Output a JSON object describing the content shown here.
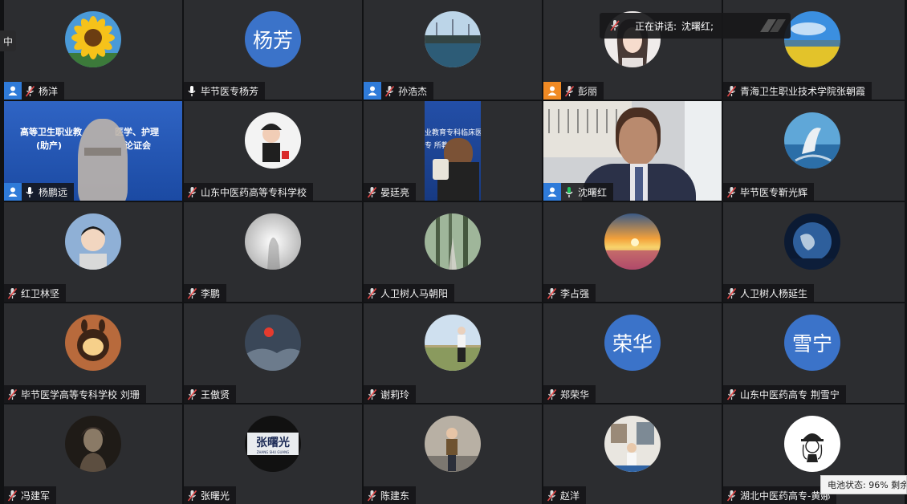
{
  "ime_indicator": "中",
  "speaking_bar": {
    "prefix": "正在讲话:",
    "name": "沈曙红;"
  },
  "battery_tooltip": "电池状态: 96% 剩余",
  "colors": {
    "host_badge": "#2f7bd9",
    "cohost_badge": "#f08a24",
    "active_speaker": "#22c55e"
  },
  "participants": [
    {
      "name": "杨洋",
      "badge": "host",
      "mic": "muted",
      "avatar": "sunflower-photo"
    },
    {
      "name": "毕节医专杨芳",
      "badge": "none",
      "mic": "on",
      "avatar_text": "杨芳",
      "avatar_color": "#3b73c9"
    },
    {
      "name": "孙浩杰",
      "badge": "host",
      "mic": "muted",
      "avatar": "harbor-photo"
    },
    {
      "name": "彭丽",
      "badge": "cohost",
      "mic": "muted",
      "avatar": "portrait-photo"
    },
    {
      "name": "青海卫生职业技术学院张朝霞",
      "badge": "none",
      "mic": "muted",
      "avatar": "field-photo"
    },
    {
      "name": "杨鹏远",
      "badge": "host",
      "mic": "on",
      "video": "slide-video",
      "slide_text_1": "高等卫生职业教",
      "slide_text_2": "医学、护理",
      "slide_text_3": "(助产)",
      "slide_text_4": "论证会"
    },
    {
      "name": "山东中医药高等专科学校",
      "badge": "none",
      "mic": "muted",
      "avatar": "child-photo"
    },
    {
      "name": "晏廷亮",
      "badge": "none",
      "mic": "muted",
      "video": "cup-video",
      "slide_text_1": "业教育专科临床医",
      "slide_text_2": "专 所教材"
    },
    {
      "name": "沈曙红",
      "badge": "host",
      "mic": "active",
      "video": "speaker-video",
      "active": true
    },
    {
      "name": "毕节医专靳光辉",
      "badge": "none",
      "mic": "muted",
      "avatar": "whale-photo"
    },
    {
      "name": "红卫林坚",
      "badge": "none",
      "mic": "muted",
      "avatar": "boy-photo"
    },
    {
      "name": "李鹏",
      "badge": "none",
      "mic": "muted",
      "avatar": "mist-photo"
    },
    {
      "name": "人卫树人马朝阳",
      "badge": "none",
      "mic": "muted",
      "avatar": "forest-photo"
    },
    {
      "name": "李占强",
      "badge": "none",
      "mic": "muted",
      "avatar": "sunset-photo"
    },
    {
      "name": "人卫树人杨延生",
      "badge": "none",
      "mic": "muted",
      "avatar": "earth-photo"
    },
    {
      "name": "毕节医学高等专科学校  刘珊",
      "badge": "none",
      "mic": "muted",
      "avatar": "lamp-photo"
    },
    {
      "name": "王傲贤",
      "badge": "none",
      "mic": "muted",
      "avatar": "sunrise-photo"
    },
    {
      "name": "谢莉玲",
      "badge": "none",
      "mic": "muted",
      "avatar": "woman-photo"
    },
    {
      "name": "郑荣华",
      "badge": "none",
      "mic": "muted",
      "avatar_text": "荣华",
      "avatar_color": "#3b73c9"
    },
    {
      "name": "山东中医药高专  荆雪宁",
      "badge": "none",
      "mic": "muted",
      "avatar_text": "雪宁",
      "avatar_color": "#3b73c9"
    },
    {
      "name": "冯建军",
      "badge": "none",
      "mic": "muted",
      "avatar": "sketch-photo"
    },
    {
      "name": "张曙光",
      "badge": "none",
      "mic": "muted",
      "avatar": "name-seal",
      "avatar_caption": "张曙光",
      "avatar_sub": "ZHANG SHU GUANG"
    },
    {
      "name": "陈建东",
      "badge": "none",
      "mic": "muted",
      "avatar": "man-street-photo"
    },
    {
      "name": "赵洋",
      "badge": "none",
      "mic": "muted",
      "avatar": "museum-photo"
    },
    {
      "name": "湖北中医药高专-黄娜",
      "badge": "none",
      "mic": "muted",
      "avatar": "cartoon-drawing"
    }
  ]
}
